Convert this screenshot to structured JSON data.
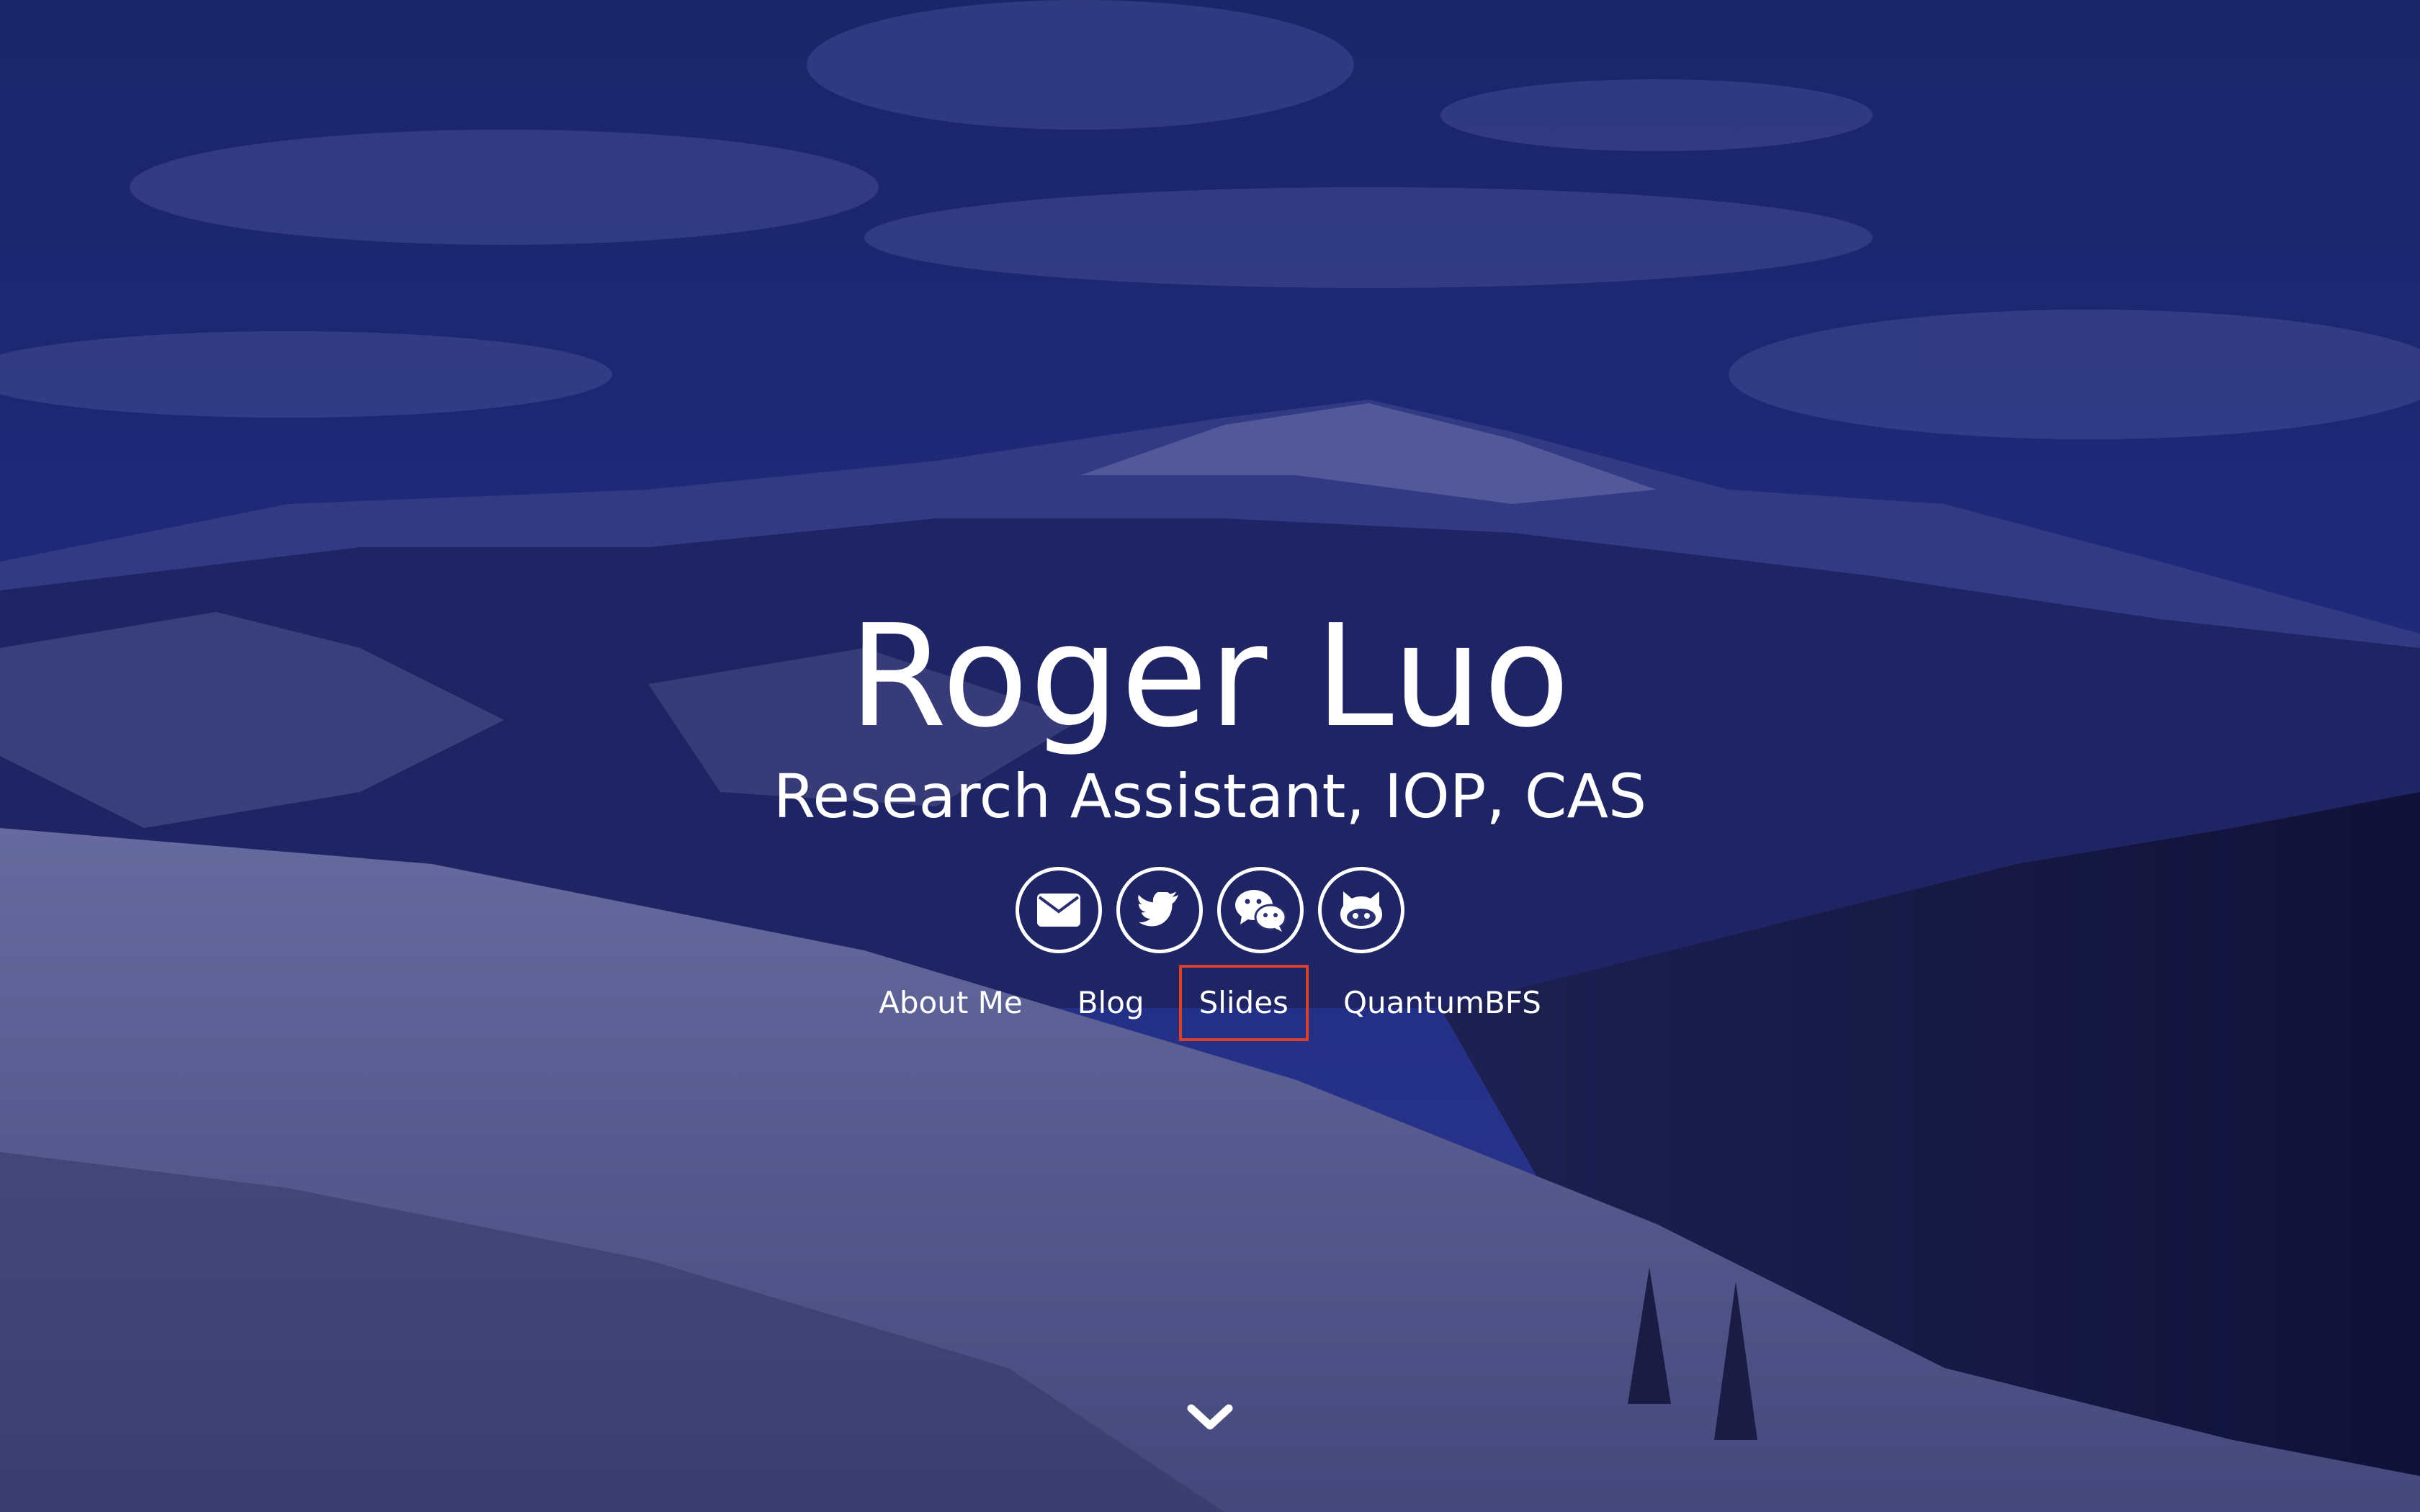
{
  "hero": {
    "name": "Roger Luo",
    "subtitle": "Research Assistant, IOP, CAS"
  },
  "social": [
    {
      "icon": "envelope-icon"
    },
    {
      "icon": "twitter-icon"
    },
    {
      "icon": "wechat-icon"
    },
    {
      "icon": "github-icon"
    }
  ],
  "nav": [
    {
      "label": "About Me"
    },
    {
      "label": "Blog"
    },
    {
      "label": "Slides",
      "highlighted": true
    },
    {
      "label": "QuantumBFS"
    }
  ],
  "scroll": {
    "icon": "chevron-down-icon"
  },
  "colors": {
    "overlay": "#1a1d5a",
    "highlight_border": "#d9412a",
    "text": "#ffffff"
  }
}
